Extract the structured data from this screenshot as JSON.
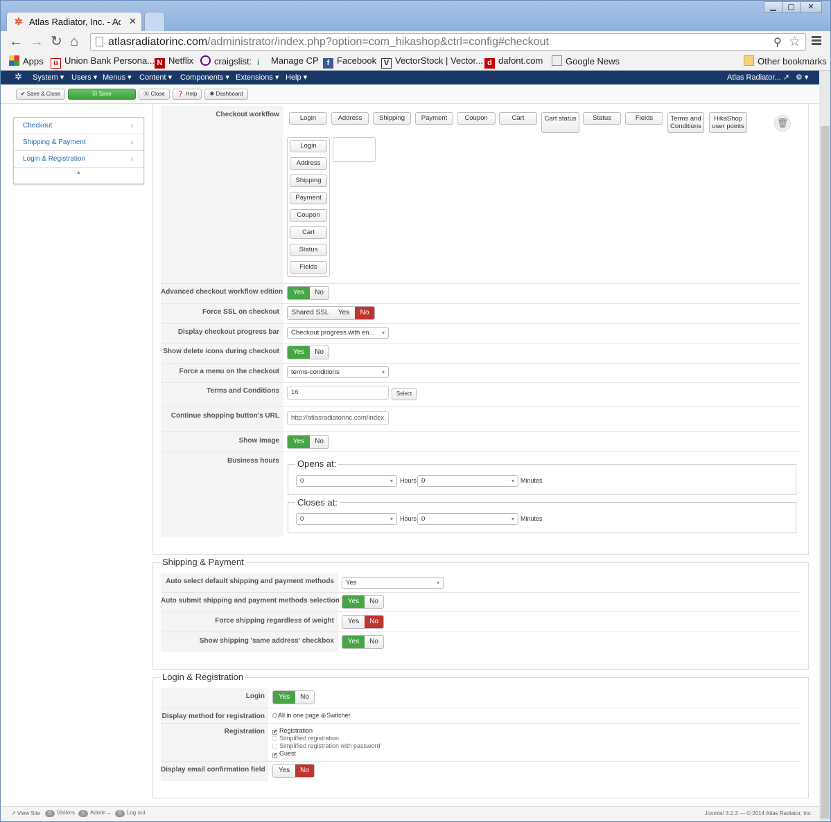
{
  "browser": {
    "tab_title": "Atlas Radiator, Inc. - Admi",
    "url_domain": "atlasradiatorinc.com",
    "url_path": "/administrator/index.php?option=com_hikashop&ctrl=config#checkout",
    "bookmarks": [
      "Apps",
      "Union Bank Persona...",
      "Netflix",
      "craigslist:",
      "Manage CP",
      "Facebook",
      "VectorStock | Vector...",
      "dafont.com",
      "Google News"
    ],
    "other_bookmarks": "Other bookmarks"
  },
  "admin_menu": {
    "items": [
      "System ▾",
      "Users ▾",
      "Menus ▾",
      "Content ▾",
      "Components ▾",
      "Extensions ▾",
      "Help ▾"
    ],
    "site_name": "Atlas Radiator... ↗",
    "gear": "⚙ ▾"
  },
  "toolbar": {
    "save_close": "✔ Save & Close",
    "save": "☑ Save",
    "close": "Ⓧ Close",
    "help": "❓ Help",
    "dashboard": "✱ Dashboard"
  },
  "sidebar": {
    "items": [
      "Checkout",
      "Shipping & Payment",
      "Login & Registration"
    ],
    "collapse": "▲"
  },
  "checkout": {
    "workflow_label": "Checkout workflow",
    "workflow_palette": [
      "Login",
      "Address",
      "Shipping",
      "Payment",
      "Coupon",
      "Cart",
      "Cart status",
      "Status",
      "Fields",
      "Terms and Conditions",
      "HikaShop user points"
    ],
    "workflow_steps": [
      "Login",
      "Address",
      "Shipping",
      "Payment",
      "Coupon",
      "Cart",
      "Status",
      "Fields"
    ],
    "advanced_label": "Advanced checkout workflow edition",
    "force_ssl_label": "Force SSL on checkout",
    "shared_ssl": "Shared SSL",
    "progress_label": "Display checkout progress bar",
    "progress_value": "Checkout progress with en...",
    "delete_icons_label": "Show delete icons during checkout",
    "force_menu_label": "Force a menu on the checkout",
    "force_menu_value": "terms-conditions",
    "terms_label": "Terms and Conditions",
    "terms_value": "16",
    "select_btn": "Select",
    "continue_label": "Continue shopping button's URL",
    "continue_value": "http://atlasradiatorinc.com/index.",
    "show_image_label": "Show image",
    "business_hours_label": "Business hours",
    "opens_at": "Opens at:",
    "closes_at": "Closes at:",
    "hours": "Hours",
    "minutes": "Minutes",
    "zero": "0"
  },
  "yes": "Yes",
  "no": "No",
  "shipping": {
    "legend": "Shipping & Payment",
    "auto_select_label": "Auto select default shipping and payment methods",
    "auto_select_value": "Yes",
    "auto_submit_label": "Auto submit shipping and payment methods selection",
    "force_shipping_label": "Force shipping regardless of weight",
    "same_address_label": "Show shipping 'same address' checkbox"
  },
  "login": {
    "legend": "Login & Registration",
    "login_label": "Login",
    "display_method_label": "Display method for registration",
    "all_in_one": "All in one page",
    "switcher": "Switcher",
    "registration_label": "Registration",
    "reg_options": [
      "Registration",
      "Simplified registration",
      "Simplified registration with password",
      "Guest"
    ],
    "email_confirm_label": "Display email confirmation field"
  },
  "status": {
    "view_site": "↗ View Site",
    "visitors_count": "0",
    "visitors": "Visitors",
    "admin_count": "1",
    "admin": "Admin",
    "dash": "–",
    "logout_count": "0",
    "logout": "Log out",
    "footer": "Joomla! 3.2.3 — © 2014 Atlas Radiator, Inc."
  }
}
